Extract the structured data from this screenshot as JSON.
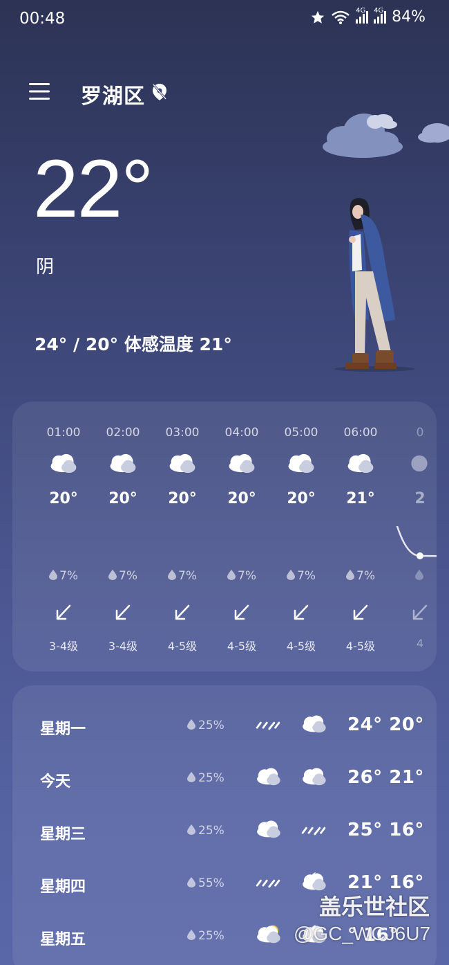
{
  "status_bar": {
    "time": "00:48",
    "network1": "4G",
    "network2": "4G",
    "battery": "84%"
  },
  "header": {
    "city": "罗湖区"
  },
  "current": {
    "temperature": "22°",
    "condition": "阴",
    "range_text": "24° / 20° 体感温度 21°"
  },
  "hourly": [
    {
      "time": "01:00",
      "temp": "20°",
      "rain": "7%",
      "wind": "3-4级",
      "icon": "cloudy-icon"
    },
    {
      "time": "02:00",
      "temp": "20°",
      "rain": "7%",
      "wind": "3-4级",
      "icon": "cloudy-icon"
    },
    {
      "time": "03:00",
      "temp": "20°",
      "rain": "7%",
      "wind": "4-5级",
      "icon": "cloudy-icon"
    },
    {
      "time": "04:00",
      "temp": "20°",
      "rain": "7%",
      "wind": "4-5级",
      "icon": "cloudy-icon"
    },
    {
      "time": "05:00",
      "temp": "20°",
      "rain": "7%",
      "wind": "4-5级",
      "icon": "cloudy-icon"
    },
    {
      "time": "06:00",
      "temp": "21°",
      "rain": "7%",
      "wind": "4-5级",
      "icon": "cloudy-icon"
    },
    {
      "time": "0",
      "temp": "2",
      "rain": "",
      "wind": "4",
      "icon": "partial-moon-icon"
    }
  ],
  "daily": [
    {
      "day": "星期一",
      "rain": "25%",
      "icon_day": "rain-icon",
      "icon_night": "cloudy-icon",
      "temps": "24° 20°"
    },
    {
      "day": "今天",
      "rain": "25%",
      "icon_day": "cloudy-icon",
      "icon_night": "cloudy-icon",
      "temps": "26° 21°"
    },
    {
      "day": "星期三",
      "rain": "25%",
      "icon_day": "cloudy-icon",
      "icon_night": "rain-icon",
      "temps": "25° 16°"
    },
    {
      "day": "星期四",
      "rain": "55%",
      "icon_day": "rain-icon",
      "icon_night": "cloudy-moon-icon",
      "temps": "21° 16°"
    },
    {
      "day": "星期五",
      "rain": "25%",
      "icon_day": "sun-cloud-icon",
      "icon_night": "cloudy-moon-icon",
      "temps": "° 16°"
    }
  ],
  "watermark": {
    "line1": "盖乐世社区",
    "line2": "@GC_WCJ6U7"
  }
}
